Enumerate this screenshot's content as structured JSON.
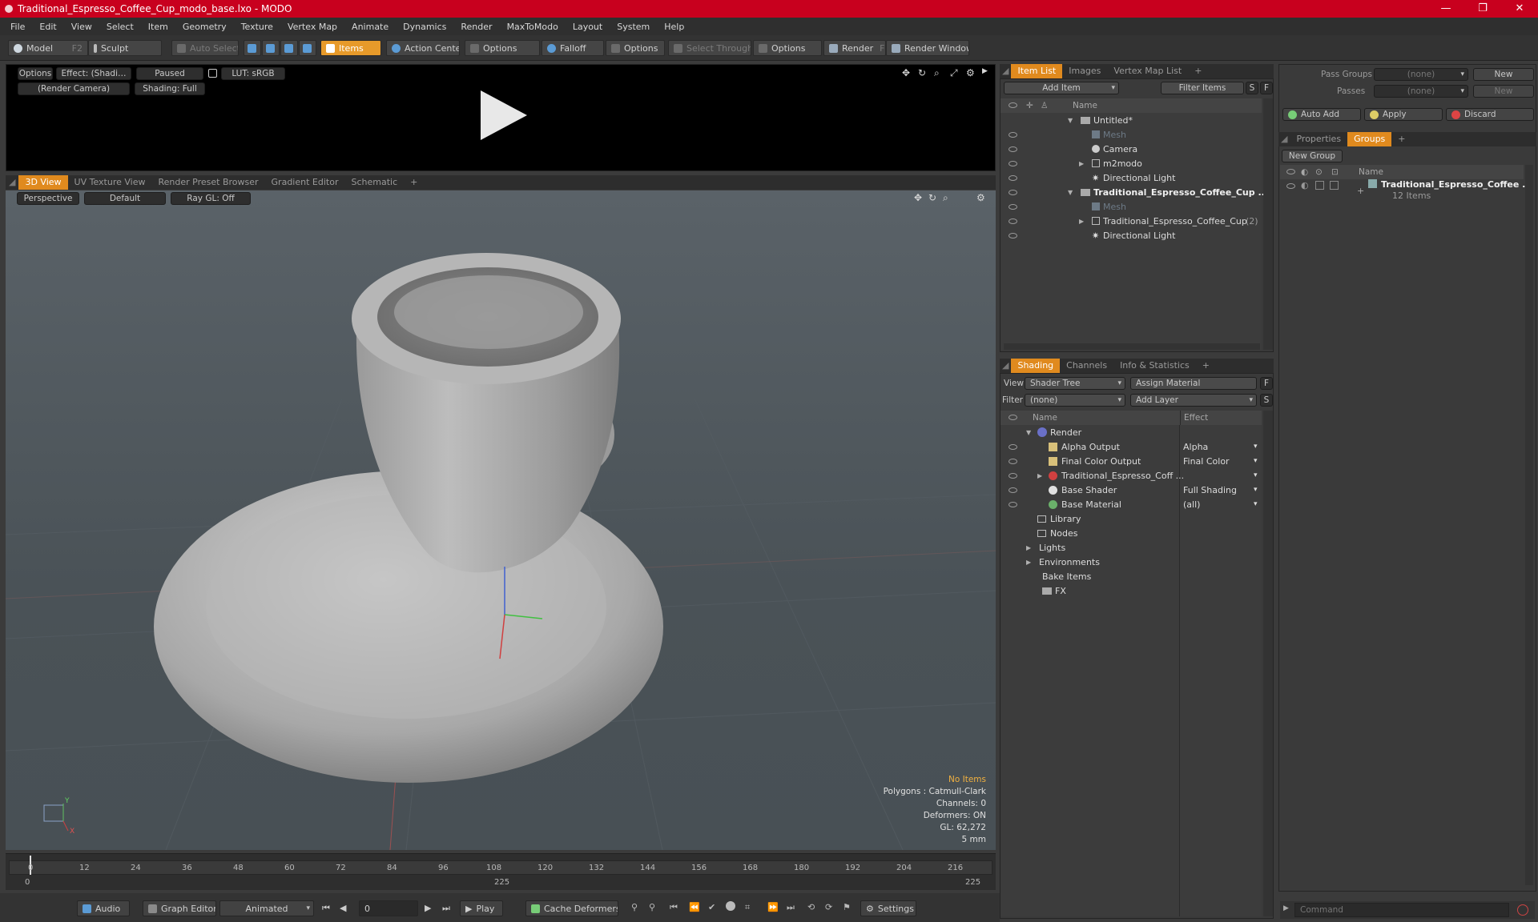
{
  "window": {
    "title": "Traditional_Espresso_Coffee_Cup_modo_base.lxo - MODO",
    "controls": [
      "—",
      "❐",
      "✕"
    ]
  },
  "menu": [
    "File",
    "Edit",
    "View",
    "Select",
    "Item",
    "Geometry",
    "Texture",
    "Vertex Map",
    "Animate",
    "Dynamics",
    "Render",
    "MaxToModo",
    "Layout",
    "System",
    "Help"
  ],
  "toolbar": {
    "model": "Model",
    "model_key": "F2",
    "sculpt": "Sculpt",
    "auto_select": "Auto Select",
    "items": "Items",
    "action_center": "Action Center",
    "options1": "Options",
    "falloff": "Falloff",
    "options2": "Options",
    "select_through": "Select Through",
    "options3": "Options",
    "render": "Render",
    "render_key": "F9",
    "render_window": "Render Window"
  },
  "preview": {
    "options": "Options",
    "effect": "Effect: (Shadi…",
    "paused": "Paused",
    "lut": "LUT: sRGB",
    "camera": "(Render Camera)",
    "shading": "Shading: Full"
  },
  "viewport_tabs": [
    "3D View",
    "UV Texture View",
    "Render Preset Browser",
    "Gradient Editor",
    "Schematic",
    "+"
  ],
  "viewport": {
    "perspective": "Perspective",
    "default": "Default",
    "raygl": "Ray GL: Off",
    "info": {
      "no_items": "No Items",
      "polygons": "Polygons : Catmull-Clark",
      "channels": "Channels: 0",
      "deformers": "Deformers: ON",
      "gl": "GL: 62,272",
      "units": "5 mm"
    },
    "axis_y": "Y",
    "axis_x": "X"
  },
  "timeline": {
    "ticks": [
      "0",
      "12",
      "24",
      "36",
      "48",
      "60",
      "72",
      "84",
      "96",
      "108",
      "120",
      "132",
      "144",
      "156",
      "168",
      "180",
      "192",
      "204",
      "216"
    ],
    "start": "0",
    "mid": "225",
    "end": "225"
  },
  "bottombar": {
    "audio": "Audio",
    "graph_editor": "Graph Editor",
    "animated": "Animated",
    "frame": "0",
    "play": "Play",
    "cache_deformers": "Cache Deformers",
    "settings": "Settings"
  },
  "item_list": {
    "tabs": [
      "Item List",
      "Images",
      "Vertex Map List",
      "+"
    ],
    "add_item": "Add Item",
    "filter_items": "Filter Items",
    "s": "S",
    "f": "F",
    "col_name": "Name",
    "rows": [
      {
        "label": "Untitled*"
      },
      {
        "label": "Mesh"
      },
      {
        "label": "Camera"
      },
      {
        "label": "m2modo"
      },
      {
        "label": "Directional Light"
      },
      {
        "label": "Traditional_Espresso_Coffee_Cup ..."
      },
      {
        "label": "Mesh"
      },
      {
        "label": "Traditional_Espresso_Coffee_Cup",
        "suffix": "(2)"
      },
      {
        "label": "Directional Light"
      }
    ]
  },
  "shading": {
    "tabs": [
      "Shading",
      "Channels",
      "Info & Statistics",
      "+"
    ],
    "view_label": "View",
    "view_value": "Shader Tree",
    "assign_material": "Assign Material",
    "filter_label": "Filter",
    "filter_value": "(none)",
    "add_layer": "Add Layer",
    "f": "F",
    "s": "S",
    "col_name": "Name",
    "col_effect": "Effect",
    "rows": [
      {
        "label": "Render",
        "effect": ""
      },
      {
        "label": "Alpha Output",
        "effect": "Alpha"
      },
      {
        "label": "Final Color Output",
        "effect": "Final Color"
      },
      {
        "label": "Traditional_Espresso_Coff ...",
        "effect": ""
      },
      {
        "label": "Base Shader",
        "effect": "Full Shading"
      },
      {
        "label": "Base Material",
        "effect": "(all)"
      },
      {
        "label": "Library",
        "effect": ""
      },
      {
        "label": "Nodes",
        "effect": ""
      },
      {
        "label": "Lights",
        "effect": ""
      },
      {
        "label": "Environments",
        "effect": ""
      },
      {
        "label": "Bake Items",
        "effect": ""
      },
      {
        "label": "FX",
        "effect": ""
      }
    ]
  },
  "groups": {
    "pass_groups": "Pass Groups",
    "pass_groups_value": "(none)",
    "new1": "New",
    "passes": "Passes",
    "passes_value": "(none)",
    "new2": "New",
    "auto_add": "Auto Add",
    "apply": "Apply",
    "discard": "Discard",
    "tabs": [
      "Properties",
      "Groups",
      "+"
    ],
    "new_group": "New Group",
    "col_name": "Name",
    "group_name": "Traditional_Espresso_Coffee ...",
    "group_count": "12 Items"
  },
  "command": {
    "placeholder": "Command"
  }
}
